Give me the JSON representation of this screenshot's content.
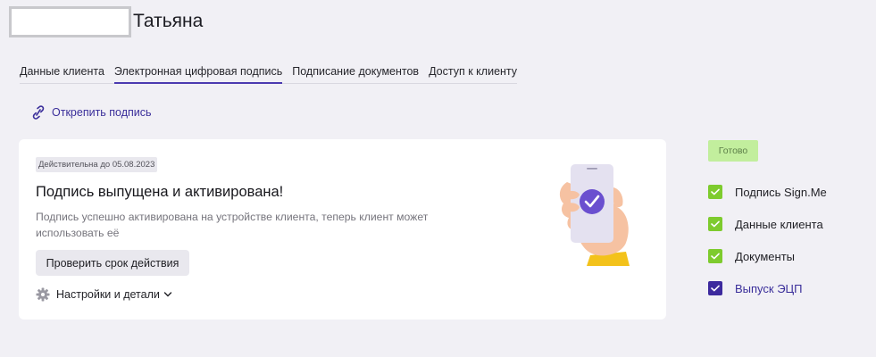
{
  "client": {
    "name": "Татьяна"
  },
  "tabs": [
    {
      "label": "Данные клиента",
      "active": false
    },
    {
      "label": "Электронная цифровая подпись",
      "active": true
    },
    {
      "label": "Подписание документов",
      "active": false
    },
    {
      "label": "Доступ к клиенту",
      "active": false
    }
  ],
  "unpin": {
    "label": "Открепить подпись",
    "icon": "link-icon"
  },
  "card": {
    "validity_badge": "Действительна до 05.08.2023",
    "title": "Подпись выпущена и активирована!",
    "description": "Подпись успешно активирована на устройстве клиента, теперь клиент может использовать её",
    "check_button": "Проверить срок действия",
    "settings_label": "Настройки и детали",
    "illustration": "phone-with-check-illustration"
  },
  "status": {
    "label": "Готово"
  },
  "steps": [
    {
      "label": "Подпись Sign.Me",
      "state": "done"
    },
    {
      "label": "Данные клиента",
      "state": "done"
    },
    {
      "label": "Документы",
      "state": "done"
    },
    {
      "label": "Выпуск ЭЦП",
      "state": "current"
    }
  ],
  "colors": {
    "accent": "#3d2a9e",
    "success": "#7ecb2e",
    "status_badge_bg": "#c2ee9d",
    "background": "#f1f0f5"
  }
}
